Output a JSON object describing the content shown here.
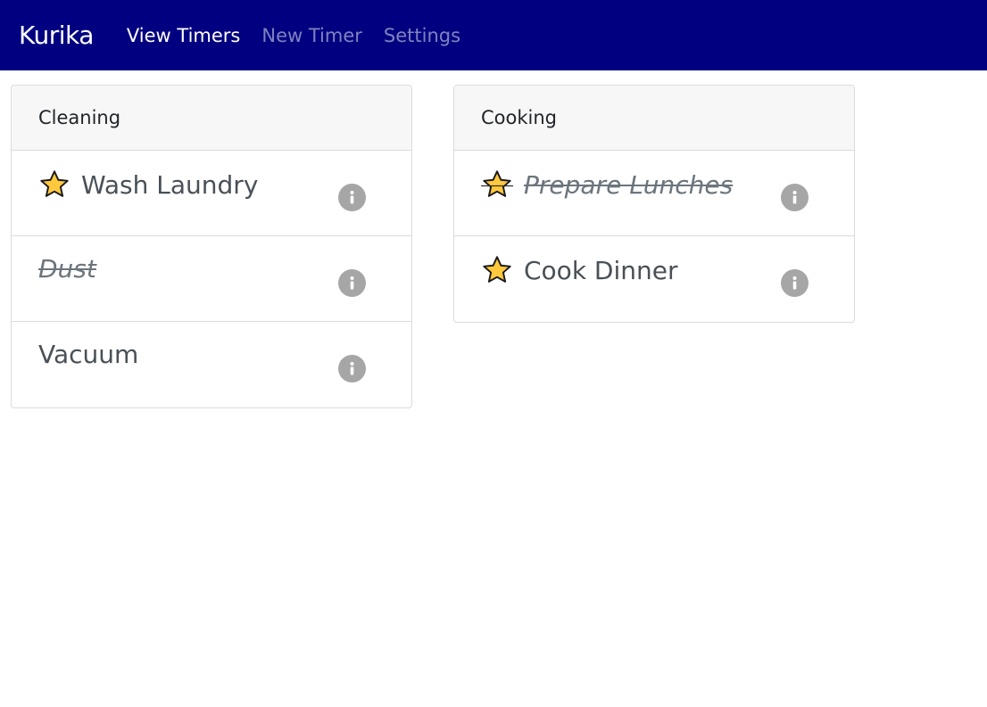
{
  "nav": {
    "brand": "Kurika",
    "links": [
      "View Timers",
      "New Timer",
      "Settings"
    ]
  },
  "groups": [
    {
      "title": "Cleaning",
      "items": [
        {
          "label": "Wash Laundry",
          "starred": true,
          "done": false
        },
        {
          "label": "Dust",
          "starred": false,
          "done": true
        },
        {
          "label": "Vacuum",
          "starred": false,
          "done": false
        }
      ]
    },
    {
      "title": "Cooking",
      "items": [
        {
          "label": "Prepare Lunches",
          "starred": true,
          "done": true
        },
        {
          "label": "Cook Dinner",
          "starred": true,
          "done": false
        }
      ]
    }
  ],
  "icons": {
    "star": "star-icon",
    "info": "info-icon"
  },
  "colors": {
    "navbar": "#000080",
    "star_fill": "#FFC83D",
    "info": "#a6a6a6"
  }
}
